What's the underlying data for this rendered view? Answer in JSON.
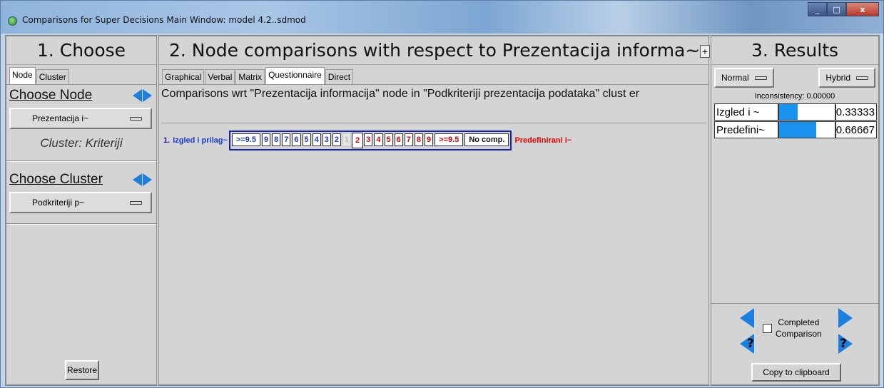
{
  "window": {
    "title": "Comparisons for Super Decisions Main Window: model 4.2..sdmod",
    "minimize": "_",
    "maximize": "□",
    "close": "x"
  },
  "choose": {
    "heading": "1. Choose",
    "tabs": [
      "Node",
      "Cluster"
    ],
    "choose_node_label": "Choose Node",
    "node_dropdown": "Prezentacija i~",
    "cluster_info": "Cluster: Kriteriji",
    "choose_cluster_label": "Choose Cluster",
    "cluster_dropdown": "Podkriteriji p~",
    "restore": "Restore"
  },
  "comparisons": {
    "heading": "2. Node comparisons with respect to Prezentacija informa~",
    "tabs": [
      "Graphical",
      "Verbal",
      "Matrix",
      "Questionnaire",
      "Direct"
    ],
    "active_tab": "Questionnaire",
    "question": "Comparisons wrt \"Prezentacija informacija\" node in \"Podkriteriji prezentacija podataka\" clust er",
    "row": {
      "number": "1.",
      "left_node": "Izgled i prilag~",
      "right_node": "Predefinirani i~",
      "left_scale": [
        ">=9.5",
        "9",
        "8",
        "7",
        "6",
        "5",
        "4",
        "3",
        "2"
      ],
      "center": "1",
      "right_scale": [
        "2",
        "3",
        "4",
        "5",
        "6",
        "7",
        "8",
        "9",
        ">=9.5"
      ],
      "selected": "2",
      "no_comp": "No comp."
    }
  },
  "results": {
    "heading": "3. Results",
    "plus": "+",
    "mode_left": "Normal",
    "mode_right": "Hybrid",
    "inconsistency": "Inconsistency: 0.00000",
    "rows": [
      {
        "name": "Izgled i ~",
        "value": "0.33333",
        "fraction": 0.33333
      },
      {
        "name": "Predefini~",
        "value": "0.66667",
        "fraction": 0.66667
      }
    ],
    "completed_line1": "Completed",
    "completed_line2": "Comparison",
    "question_mark": "?",
    "copy": "Copy to clipboard"
  }
}
